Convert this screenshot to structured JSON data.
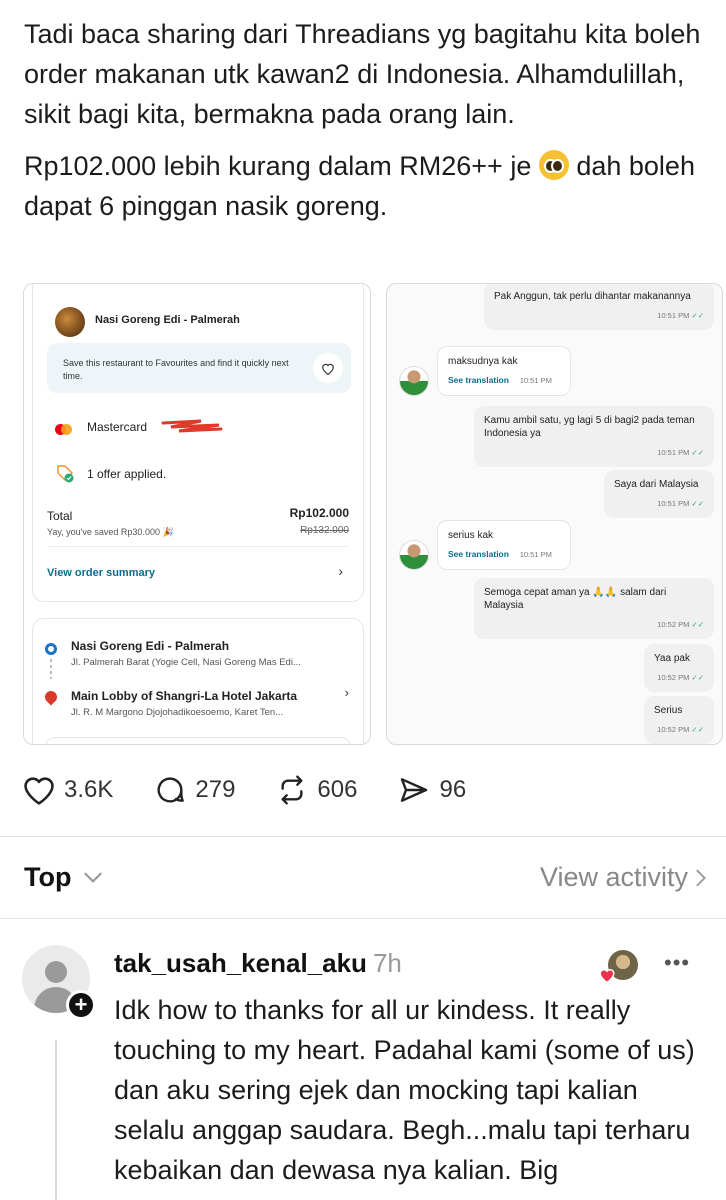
{
  "post": {
    "paragraph1": "Tadi baca sharing dari Threadians yg bagitahu kita boleh order makanan utk kawan2 di Indonesia. Alhamdulillah, sikit bagi kita, bermakna pada orang lain.",
    "paragraph2_a": "Rp102.000 lebih kurang dalam RM26++ je ",
    "paragraph2_b": " dah boleh dapat 6 pinggan nasik goreng."
  },
  "order_screenshot": {
    "restaurant": "Nasi Goreng Edi - Palmerah",
    "favourite_text": "Save this restaurant to Favourites and find it quickly next time.",
    "payment_method": "Mastercard",
    "offer_text": "1 offer applied.",
    "total_label": "Total",
    "total_amount": "Rp102.000",
    "saved_text": "Yay, you've saved Rp30.000 🎉",
    "original_amount": "Rp132.000",
    "view_summary": "View order summary",
    "pickup_name": "Nasi Goreng Edi - Palmerah",
    "pickup_address": "Jl. Palmerah Barat (Yogie Cell, Nasi Goreng Mas Edi...",
    "dropoff_name": "Main Lobby of Shangri-La Hotel Jakarta",
    "dropoff_address": "Jl. R. M Margono Djojohadikoesoemo, Karet Ten..."
  },
  "chat_screenshot": {
    "see_translation": "See translation",
    "messages": [
      {
        "side": "out",
        "text": "Pak Anggun, tak perlu dihantar makanannya",
        "time": "10:51 PM"
      },
      {
        "side": "in",
        "text": "maksudnya kak",
        "time": "10:51 PM"
      },
      {
        "side": "out",
        "text": "Kamu ambil satu, yg lagi 5 di bagi2 pada teman Indonesia ya",
        "time": "10:51 PM"
      },
      {
        "side": "out",
        "text": "Saya dari Malaysia",
        "time": "10:51 PM"
      },
      {
        "side": "in",
        "text": "serius kak",
        "time": "10:51 PM"
      },
      {
        "side": "out",
        "text": "Semoga cepat aman ya 🙏🙏 salam dari Malaysia",
        "time": "10:52 PM"
      },
      {
        "side": "out",
        "text": "Yaa pak",
        "time": "10:52 PM"
      },
      {
        "side": "out",
        "text": "Serius",
        "time": "10:52 PM"
      }
    ]
  },
  "actions": {
    "likes": "3.6K",
    "replies": "279",
    "reposts": "606",
    "shares": "96"
  },
  "sort": {
    "label": "Top",
    "view_activity": "View activity"
  },
  "reply": {
    "username": "tak_usah_kenal_aku",
    "time": "7h",
    "text": "Idk how to thanks for all ur kindess. It really touching to my heart. Padahal kami (some of us) dan aku sering ejek dan mocking tapi kalian selalu anggap saudara. Begh...malu tapi terharu kebaikan dan dewasa nya kalian. Big"
  }
}
